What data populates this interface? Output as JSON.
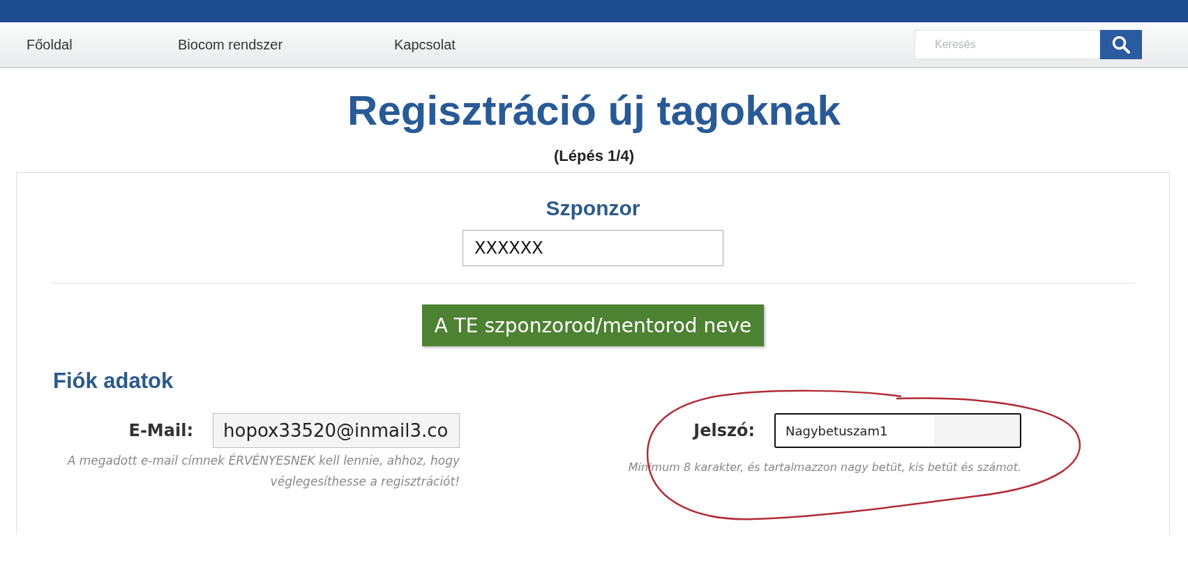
{
  "nav": {
    "items": [
      {
        "label": "Főoldal"
      },
      {
        "label": "Biocom rendszer"
      },
      {
        "label": "Kapcsolat"
      }
    ],
    "search": {
      "placeholder": "Keresés"
    }
  },
  "title": "Regisztráció új tagoknak",
  "step": "(Lépés 1/4)",
  "sponsor": {
    "heading": "Szponzor",
    "value": "XXXXXX",
    "button": "A TE szponzorod/mentorod neve"
  },
  "account": {
    "heading": "Fiók adatok",
    "fields": [
      {
        "label": "E-Mail:",
        "value": "hopox33520@inmail3.co",
        "hint": "A megadott e-mail címnek ÉRVÉNYESNEK kell lennie, ahhoz, hogy véglegesíthesse a regisztrációt!",
        "focused": false
      },
      {
        "label": "Jelszó:",
        "value": "Nagybetuszam1",
        "hint": "Minimum 8 karakter, és tartalmazzon nagy betüt, kis betüt és számot.",
        "focused": true
      }
    ]
  }
}
